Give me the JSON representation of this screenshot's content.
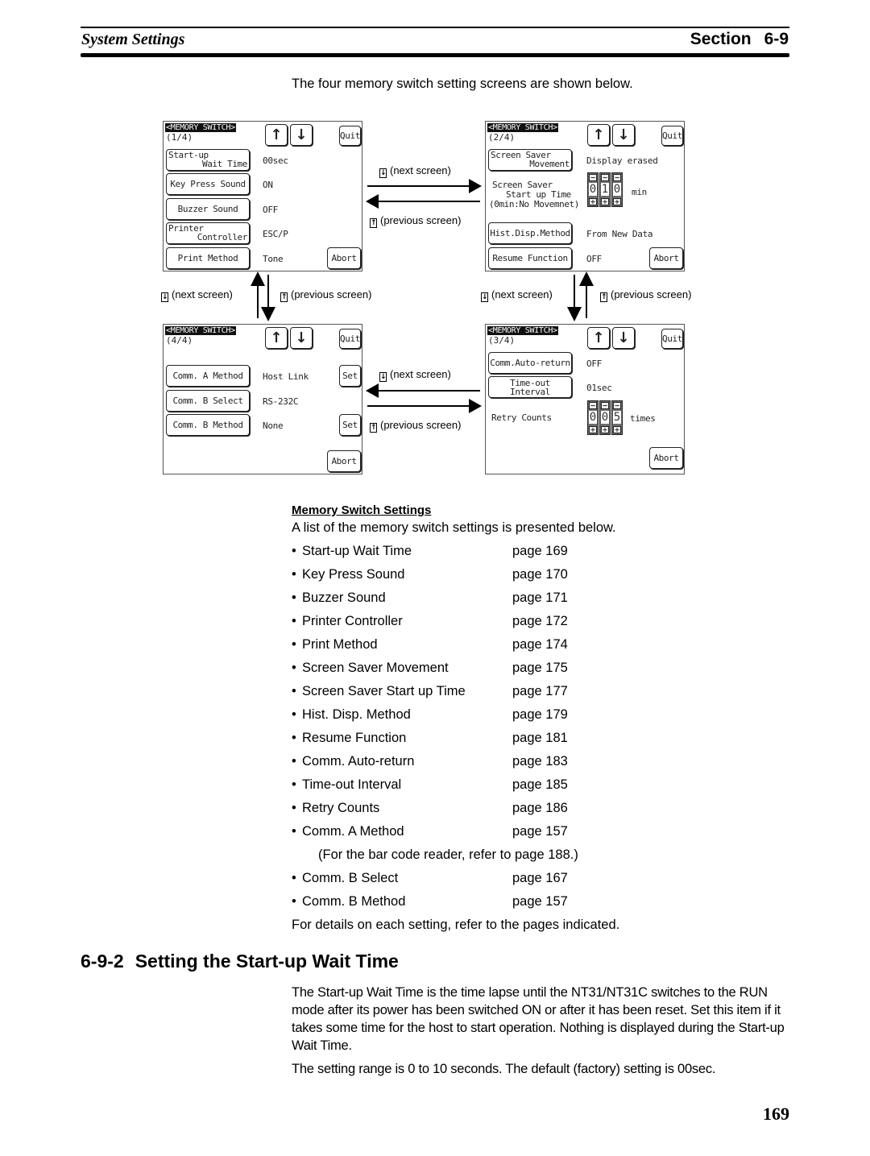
{
  "header": {
    "chapter_title": "System Settings",
    "section_label": "Section",
    "section_number": "6-9"
  },
  "intro_text": "The four memory switch setting screens are shown below.",
  "screens": {
    "common": {
      "title": "<MEMORY SWITCH>",
      "up_symbol": "↑",
      "down_symbol": "↓",
      "quit_label": "Quit",
      "abort_label": "Abort",
      "set_label": "Set"
    },
    "s1": {
      "page": "(1/4)",
      "rows": [
        {
          "label_l1": "Start-up",
          "label_l2": "Wait Time",
          "value": "00sec"
        },
        {
          "label": "Key Press Sound",
          "value": "ON"
        },
        {
          "label": "Buzzer Sound",
          "value": "OFF"
        },
        {
          "label_l1": "Printer",
          "label_l2": "Controller",
          "value": "ESC/P"
        },
        {
          "label": "Print Method",
          "value": "Tone"
        }
      ]
    },
    "s2": {
      "page": "(2/4)",
      "saver_btn_l1": "Screen Saver",
      "saver_btn_l2": "Movement",
      "saver_value": "Display erased",
      "start_label_l1": "Screen Saver",
      "start_label_l2": "Start up Time",
      "start_label_l3": "(0min:No Movemnet)",
      "start_digits": [
        "0",
        "1",
        "0"
      ],
      "start_unit": "min",
      "hist_label": "Hist.Disp.Method",
      "hist_value": "From New Data",
      "resume_label": "Resume Function",
      "resume_value": "OFF"
    },
    "s3": {
      "page": "(3/4)",
      "auto_label": "Comm.Auto-return",
      "auto_value": "OFF",
      "timeout_label": "Time-out Interval",
      "timeout_value": "01sec",
      "retry_label": "Retry Counts",
      "retry_digits": [
        "0",
        "0",
        "5"
      ],
      "retry_unit": "times"
    },
    "s4": {
      "page": "(4/4)",
      "a_method_label": "Comm. A Method",
      "a_method_value": "Host Link",
      "b_select_label": "Comm. B Select",
      "b_select_value": "RS-232C",
      "b_method_label": "Comm. B Method",
      "b_method_value": "None"
    }
  },
  "navigation": {
    "next_key": "↓",
    "prev_key": "↑",
    "next_text": "(next screen)",
    "prev_text": "(previous screen)"
  },
  "memory_switch_settings": {
    "heading": "Memory Switch Settings",
    "intro": "A list of the memory switch settings is presented below.",
    "bullet": "•",
    "items": [
      {
        "name": "Start-up Wait Time",
        "page": "page 169"
      },
      {
        "name": "Key Press Sound",
        "page": "page 170"
      },
      {
        "name": "Buzzer Sound",
        "page": "page 171"
      },
      {
        "name": "Printer Controller",
        "page": "page 172"
      },
      {
        "name": "Print Method",
        "page": "page 174"
      },
      {
        "name": "Screen Saver Movement",
        "page": "page 175"
      },
      {
        "name": "Screen Saver Start up Time",
        "page": "page 177"
      },
      {
        "name": "Hist. Disp. Method",
        "page": "page 179"
      },
      {
        "name": "Resume Function",
        "page": "page 181"
      },
      {
        "name": "Comm. Auto-return",
        "page": "page 183"
      },
      {
        "name": "Time-out Interval",
        "page": "page 185"
      },
      {
        "name": "Retry Counts",
        "page": "page 186"
      },
      {
        "name": "Comm. A Method",
        "page": "page 157"
      },
      {
        "name": "Comm. B Select",
        "page": "page 167"
      },
      {
        "name": "Comm. B Method",
        "page": "page 157"
      }
    ],
    "note": "(For the bar code reader, refer to page 188.)",
    "details": "For details on each setting, refer to the pages indicated."
  },
  "section": {
    "number": "6-9-2",
    "title": "Setting the Start-up Wait Time",
    "paragraph1": "The Start-up Wait Time is the time lapse until the NT31/NT31C switches to the RUN mode after its power has been switched ON or after it has been reset. Set this item if it takes some time for the host to start operation. Nothing is displayed during the Start-up Wait Time.",
    "paragraph2": "The setting range is 0 to 10 seconds. The default (factory) setting is 00sec."
  },
  "page_number": "169"
}
